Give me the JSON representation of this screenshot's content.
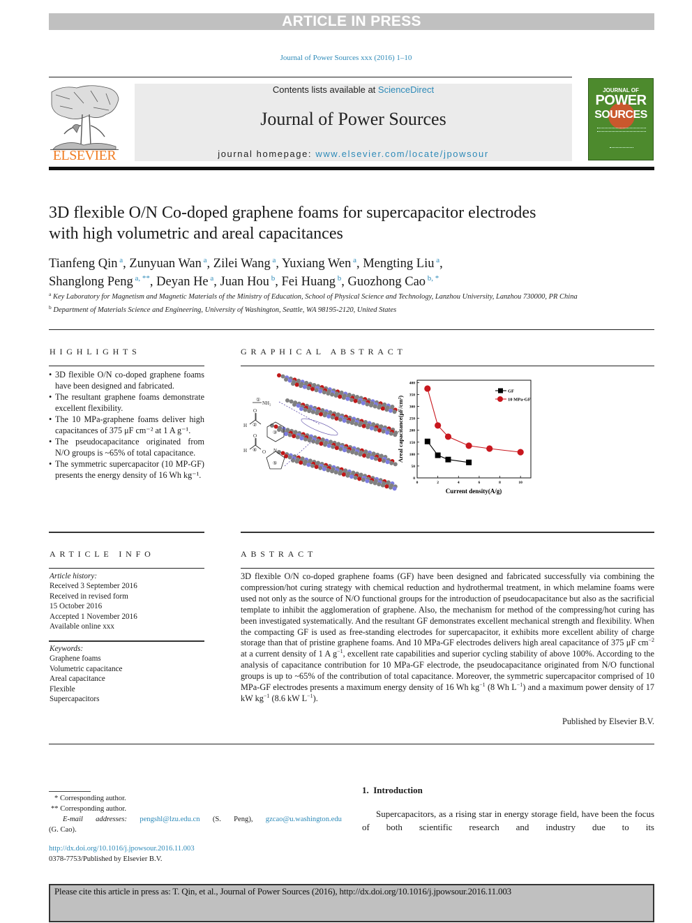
{
  "banner": "ARTICLE IN PRESS",
  "journal_ref": "Journal of Power Sources xxx (2016) 1–10",
  "masthead": {
    "contents_prefix": "Contents lists available at ",
    "contents_link": "ScienceDirect",
    "journal_name": "Journal of Power Sources",
    "homepage_prefix": "journal homepage: ",
    "homepage_link": "www.elsevier.com/locate/jpowsour"
  },
  "publisher_logo_text": "ELSEVIER",
  "cover": {
    "line1": "JOURNAL OF",
    "line2": "POWER",
    "line3": "SOURCES"
  },
  "article": {
    "title": "3D flexible O/N Co-doped graphene foams for supercapacitor electrodes with high volumetric and areal capacitances",
    "authors": [
      {
        "name": "Tianfeng Qin",
        "sup": "a",
        "sep": ", "
      },
      {
        "name": "Zunyuan Wan",
        "sup": "a",
        "sep": ", "
      },
      {
        "name": "Zilei Wang",
        "sup": "a",
        "sep": ", "
      },
      {
        "name": "Yuxiang Wen",
        "sup": "a",
        "sep": ", "
      },
      {
        "name": "Mengting Liu",
        "sup": "a",
        "sep": ","
      },
      {
        "name": "Shanglong Peng",
        "sup": "a, **",
        "sep": ", "
      },
      {
        "name": "Deyan He",
        "sup": "a",
        "sep": ", "
      },
      {
        "name": "Juan Hou",
        "sup": "b",
        "sep": ", "
      },
      {
        "name": "Fei Huang",
        "sup": "b",
        "sep": ", "
      },
      {
        "name": "Guozhong Cao",
        "sup": "b, *",
        "sep": ""
      }
    ],
    "affiliations": [
      {
        "label": "a",
        "text": "Key Laboratory for Magnetism and Magnetic Materials of the Ministry of Education, School of Physical Science and Technology, Lanzhou University, Lanzhou 730000, PR China"
      },
      {
        "label": "b",
        "text": "Department of Materials Science and Engineering, University of Washington, Seattle, WA 98195-2120, United States"
      }
    ]
  },
  "highlights": {
    "heading": "HIGHLIGHTS",
    "items": [
      "3D flexible O/N co-doped graphene foams have been designed and fabricated.",
      "The resultant graphene foams demonstrate excellent flexibility.",
      "The 10 MPa-graphene foams deliver high capacitances of 375 μF cm⁻² at 1 A g⁻¹.",
      "The pseudocapacitance originated from N/O groups is ~65% of total capacitance.",
      "The symmetric supercapacitor (10 MP-GF) presents the energy density of 16 Wh kg⁻¹."
    ]
  },
  "graphical_abstract": {
    "heading": "GRAPHICAL ABSTRACT",
    "structure_labels": {
      "g1": "①",
      "nh2": "NH₂",
      "g2": "②",
      "g3": "③",
      "g4": "④",
      "g5": "⑤",
      "h": "H",
      "o": "O",
      "n": "N"
    }
  },
  "chart_data": {
    "type": "line",
    "title": "",
    "xlabel": "Current density(A/g)",
    "ylabel": "Areal capacitance(μF/cm²)",
    "xlim": [
      0,
      11
    ],
    "ylim": [
      0,
      410
    ],
    "xticks": [
      0,
      2,
      4,
      6,
      8,
      10
    ],
    "yticks": [
      0,
      50,
      100,
      150,
      200,
      250,
      300,
      350,
      400
    ],
    "legend_position": "top-right",
    "grid": false,
    "series": [
      {
        "name": "GF",
        "marker": "square",
        "color": "#000000",
        "x": [
          1,
          2,
          3,
          5
        ],
        "y": [
          153,
          95,
          77,
          65
        ]
      },
      {
        "name": "10 MPa-GF",
        "marker": "circle",
        "color": "#c8171e",
        "x": [
          1,
          2,
          3,
          5,
          7,
          10
        ],
        "y": [
          375,
          220,
          173,
          135,
          123,
          108
        ]
      }
    ]
  },
  "article_info": {
    "heading": "ARTICLE INFO",
    "history_label": "Article history:",
    "history": [
      "Received 3 September 2016",
      "Received in revised form",
      "15 October 2016",
      "Accepted 1 November 2016",
      "Available online xxx"
    ],
    "keywords_label": "Keywords:",
    "keywords": [
      "Graphene foams",
      "Volumetric capacitance",
      "Areal capacitance",
      "Flexible",
      "Supercapacitors"
    ]
  },
  "abstract": {
    "heading": "ABSTRACT",
    "text_parts": {
      "p1": "3D flexible O/N co-doped graphene foams (GF) have been designed and fabricated successfully via combining the compression/hot curing strategy with chemical reduction and hydrothermal treatment, in which melamine foams were used not only as the source of N/O functional groups for the introduction of pseudocapacitance but also as the sacrificial template to inhibit the agglomeration of graphene. Also, the mechanism for method of the compressing/hot curing has been investigated systematically. And the resultant GF demonstrates excellent mechanical strength and flexibility. When the compacting GF is used as free-standing electrodes for supercapacitor, it exhibits more excellent ability of charge storage than that of pristine graphene foams. And 10 MPa-GF electrodes delivers high areal capacitance of 375 μF cm",
      "s1": "−2",
      "p2": " at a current density of 1 A g",
      "s2": "−1",
      "p3": ", excellent rate capabilities and superior cycling stability of above 100%. According to the analysis of capacitance contribution for 10 MPa-GF electrode, the pseudocapacitance originated from N/O functional groups is up to ~65% of the contribution of total capacitance. Moreover, the symmetric supercapacitor comprised of 10 MPa-GF electrodes presents a maximum energy density of 16 Wh kg",
      "s3": "−1",
      "p4": " (8 Wh L",
      "s4": "−1",
      "p5": ") and a maximum power density of 17 kW kg",
      "s5": "−1",
      "p6": " (8.6 kW L",
      "s6": "−1",
      "p7": ")."
    },
    "published_by": "Published by Elsevier B.V."
  },
  "footnotes": {
    "star1": "* Corresponding author.",
    "star2": "** Corresponding author.",
    "email_label": "E-mail addresses:",
    "email1": "pengshl@lzu.edu.cn",
    "email1_name": "(S. Peng),",
    "email2": "gzcao@u.washington.edu",
    "email2_name": "(G. Cao).",
    "doi": "http://dx.doi.org/10.1016/j.jpowsour.2016.11.003",
    "issn": "0378-7753/Published by Elsevier B.V."
  },
  "introduction": {
    "heading": "1.  Introduction",
    "text": "Supercapacitors, as a rising star in energy storage field, have been the focus of both scientific research and industry due to its"
  },
  "citation_box": "Please cite this article in press as: T. Qin, et al., Journal of Power Sources (2016), http://dx.doi.org/10.1016/j.jpowsour.2016.11.003"
}
